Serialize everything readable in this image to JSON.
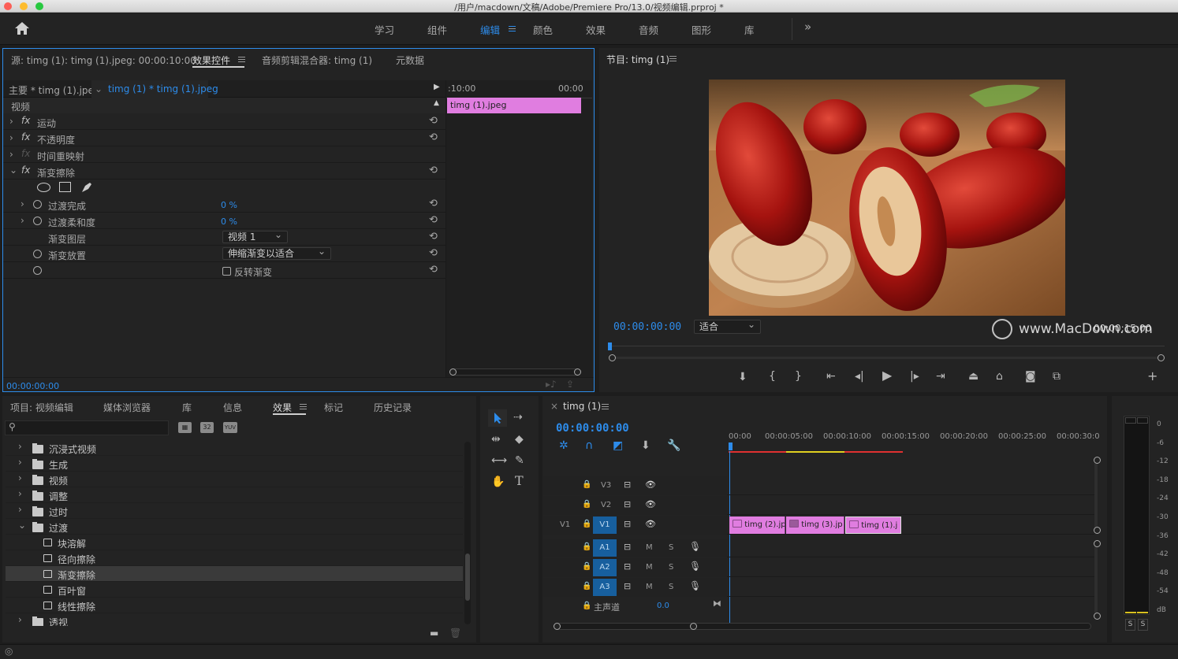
{
  "window": {
    "title": "/用户/macdown/文稿/Adobe/Premiere Pro/13.0/视频编辑.prproj *"
  },
  "workspaces": [
    "学习",
    "组件",
    "编辑",
    "颜色",
    "效果",
    "音频",
    "图形",
    "库"
  ],
  "source_panel": {
    "tabs": [
      "源: timg (1): timg (1).jpeg: 00:00:10:00",
      "效果控件",
      "音频剪辑混合器: timg (1)",
      "元数据"
    ],
    "master_label": "主要 * timg (1).jpeg",
    "clip_label": "timg (1) * timg (1).jpeg",
    "video_header": "视频",
    "effects": [
      {
        "name": "运动"
      },
      {
        "name": "不透明度"
      },
      {
        "name": "时间重映射"
      },
      {
        "name": "渐变擦除"
      }
    ],
    "params": {
      "completion": {
        "label": "过渡完成",
        "value": "0 %"
      },
      "softness": {
        "label": "过渡柔和度",
        "value": "0 %"
      },
      "layer": {
        "label": "渐变图层",
        "value": "视频 1"
      },
      "placement": {
        "label": "渐变放置",
        "value": "伸缩渐变以适合"
      },
      "invert": {
        "label": "反转渐变",
        "checked": false
      }
    },
    "mini_timeline": {
      "start": ":10:00",
      "end": "00:00",
      "clip": "timg (1).jpeg"
    },
    "timecode": "00:00:00:00"
  },
  "program_panel": {
    "title": "节目: timg (1)",
    "timecode": "00:00:00:00",
    "fit": "适合",
    "duration": "00:00:15:00",
    "watermark": "www.MacDown.com"
  },
  "project_panel": {
    "tabs": [
      "项目: 视频编辑",
      "媒体浏览器",
      "库",
      "信息",
      "效果",
      "标记",
      "历史记录"
    ],
    "badges": [
      "32",
      "YUV"
    ],
    "tree": [
      {
        "label": "沉浸式视频",
        "type": "folder"
      },
      {
        "label": "生成",
        "type": "folder"
      },
      {
        "label": "视频",
        "type": "folder"
      },
      {
        "label": "调整",
        "type": "folder"
      },
      {
        "label": "过时",
        "type": "folder"
      },
      {
        "label": "过渡",
        "type": "folder",
        "open": true
      },
      {
        "label": "块溶解",
        "type": "effect"
      },
      {
        "label": "径向擦除",
        "type": "effect"
      },
      {
        "label": "渐变擦除",
        "type": "effect",
        "selected": true
      },
      {
        "label": "百叶窗",
        "type": "effect"
      },
      {
        "label": "线性擦除",
        "type": "effect"
      },
      {
        "label": "透视",
        "type": "folder"
      }
    ]
  },
  "timeline": {
    "tab": "timg (1)",
    "timecode": "00:00:00:00",
    "ruler": [
      "00:00",
      "00:00:05:00",
      "00:00:10:00",
      "00:00:15:00",
      "00:00:20:00",
      "00:00:25:00",
      "00:00:30:0"
    ],
    "video_tracks": [
      "V3",
      "V2",
      "V1"
    ],
    "source_patch": "V1",
    "audio_tracks": [
      "A1",
      "A2",
      "A3"
    ],
    "master": {
      "label": "主声道",
      "value": "0.0"
    },
    "clips": [
      "timg (2).jp",
      "timg (3).jp",
      "timg (1).j"
    ],
    "ms": {
      "m": "M",
      "s": "S"
    }
  },
  "meter": {
    "scale": [
      "0",
      "-6",
      "-12",
      "-18",
      "-24",
      "-30",
      "-36",
      "-42",
      "-48",
      "-54",
      "dB"
    ],
    "solo": [
      "S",
      "S"
    ]
  },
  "colors": {
    "accent": "#2d8ceb",
    "clip": "#e07de0",
    "track_blue": "#175f9e"
  }
}
